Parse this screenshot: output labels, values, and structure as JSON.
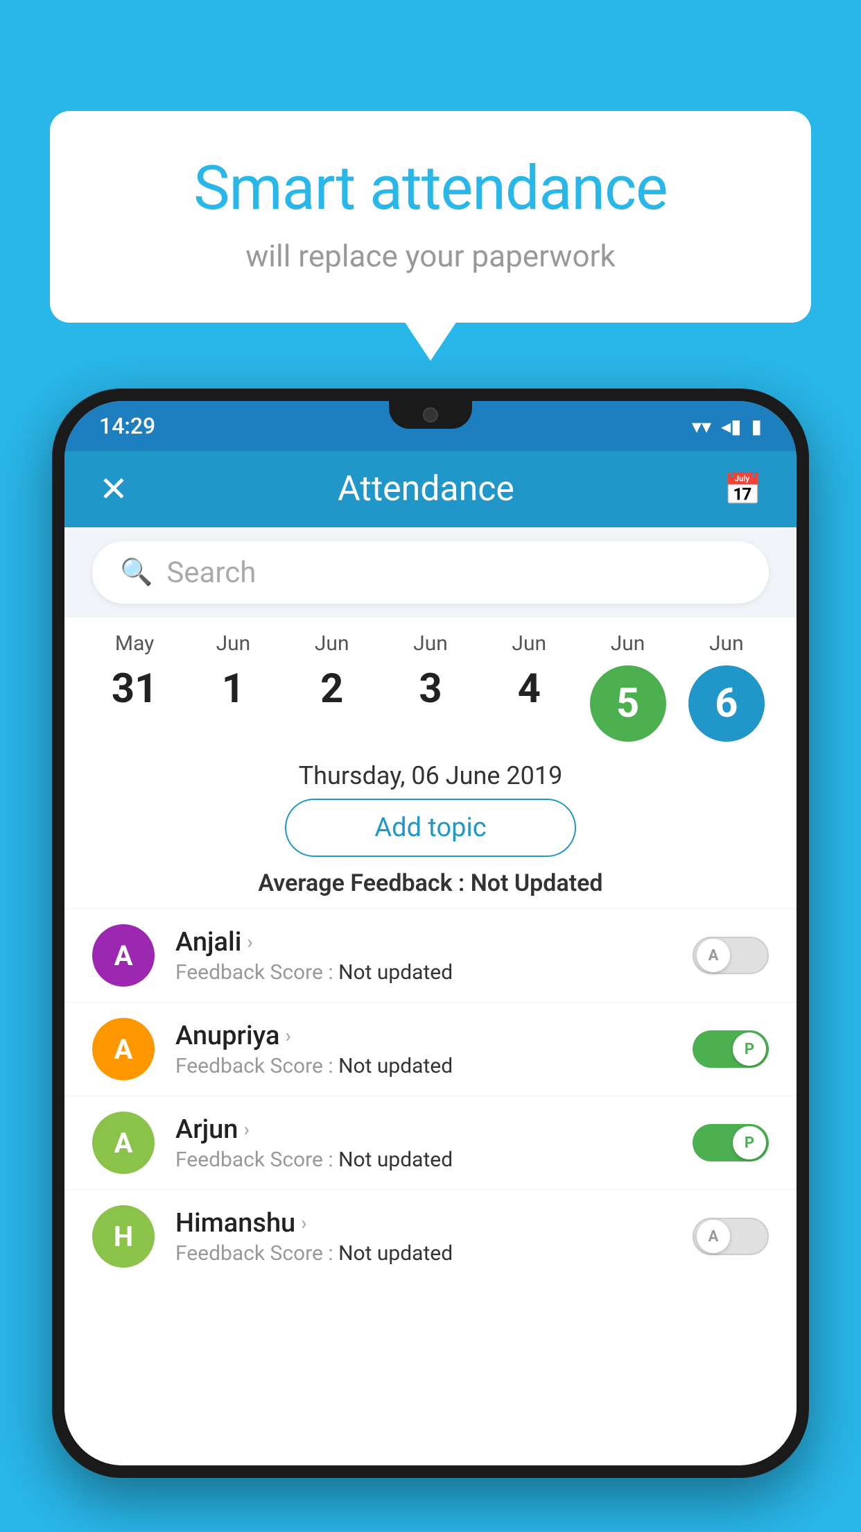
{
  "background_color": "#29b6e8",
  "bubble": {
    "title": "Smart attendance",
    "subtitle": "will replace your paperwork"
  },
  "status_bar": {
    "time": "14:29",
    "wifi": "▾",
    "signal": "◂",
    "battery": "▮"
  },
  "header": {
    "title": "Attendance",
    "close_label": "✕",
    "calendar_label": "📅"
  },
  "search": {
    "placeholder": "Search"
  },
  "calendar": {
    "dates": [
      {
        "month": "May",
        "day": "31",
        "circle": false
      },
      {
        "month": "Jun",
        "day": "1",
        "circle": false
      },
      {
        "month": "Jun",
        "day": "2",
        "circle": false
      },
      {
        "month": "Jun",
        "day": "3",
        "circle": false
      },
      {
        "month": "Jun",
        "day": "4",
        "circle": false
      },
      {
        "month": "Jun",
        "day": "5",
        "circle": "green"
      },
      {
        "month": "Jun",
        "day": "6",
        "circle": "blue"
      }
    ]
  },
  "selected_date": "Thursday, 06 June 2019",
  "add_topic_label": "Add topic",
  "avg_feedback_label": "Average Feedback :",
  "avg_feedback_value": "Not Updated",
  "students": [
    {
      "name": "Anjali",
      "avatar_letter": "A",
      "avatar_color": "#9c27b0",
      "feedback_label": "Feedback Score :",
      "feedback_value": "Not updated",
      "toggle_state": "off",
      "toggle_letter": "A"
    },
    {
      "name": "Anupriya",
      "avatar_letter": "A",
      "avatar_color": "#ff9800",
      "feedback_label": "Feedback Score :",
      "feedback_value": "Not updated",
      "toggle_state": "on",
      "toggle_letter": "P"
    },
    {
      "name": "Arjun",
      "avatar_letter": "A",
      "avatar_color": "#8bc34a",
      "feedback_label": "Feedback Score :",
      "feedback_value": "Not updated",
      "toggle_state": "on",
      "toggle_letter": "P"
    },
    {
      "name": "Himanshu",
      "avatar_letter": "H",
      "avatar_color": "#8bc34a",
      "feedback_label": "Feedback Score :",
      "feedback_value": "Not updated",
      "toggle_state": "off",
      "toggle_letter": "A"
    }
  ]
}
